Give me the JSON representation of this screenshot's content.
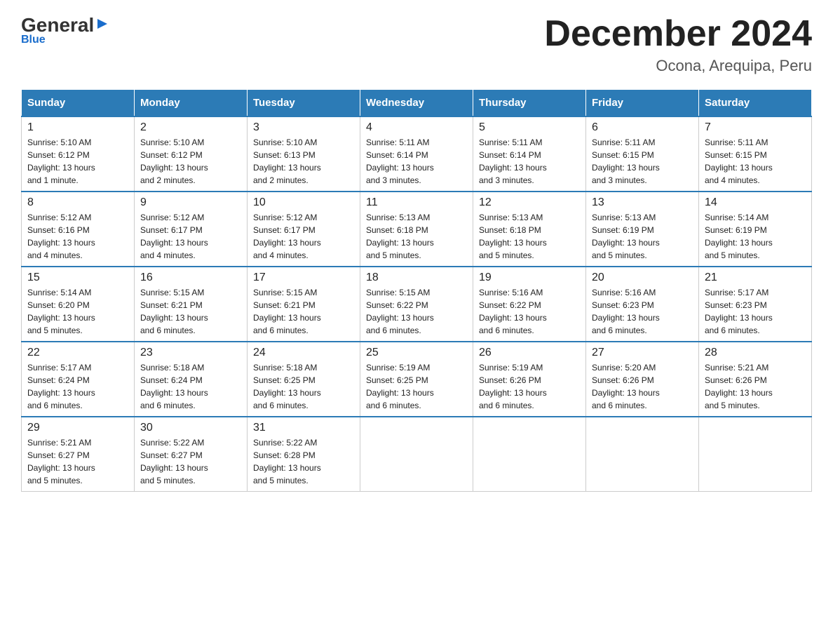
{
  "logo": {
    "general": "General",
    "blue": "Blue"
  },
  "title": "December 2024",
  "subtitle": "Ocona, Arequipa, Peru",
  "days_header": [
    "Sunday",
    "Monday",
    "Tuesday",
    "Wednesday",
    "Thursday",
    "Friday",
    "Saturday"
  ],
  "weeks": [
    [
      {
        "num": "1",
        "info": "Sunrise: 5:10 AM\nSunset: 6:12 PM\nDaylight: 13 hours\nand 1 minute."
      },
      {
        "num": "2",
        "info": "Sunrise: 5:10 AM\nSunset: 6:12 PM\nDaylight: 13 hours\nand 2 minutes."
      },
      {
        "num": "3",
        "info": "Sunrise: 5:10 AM\nSunset: 6:13 PM\nDaylight: 13 hours\nand 2 minutes."
      },
      {
        "num": "4",
        "info": "Sunrise: 5:11 AM\nSunset: 6:14 PM\nDaylight: 13 hours\nand 3 minutes."
      },
      {
        "num": "5",
        "info": "Sunrise: 5:11 AM\nSunset: 6:14 PM\nDaylight: 13 hours\nand 3 minutes."
      },
      {
        "num": "6",
        "info": "Sunrise: 5:11 AM\nSunset: 6:15 PM\nDaylight: 13 hours\nand 3 minutes."
      },
      {
        "num": "7",
        "info": "Sunrise: 5:11 AM\nSunset: 6:15 PM\nDaylight: 13 hours\nand 4 minutes."
      }
    ],
    [
      {
        "num": "8",
        "info": "Sunrise: 5:12 AM\nSunset: 6:16 PM\nDaylight: 13 hours\nand 4 minutes."
      },
      {
        "num": "9",
        "info": "Sunrise: 5:12 AM\nSunset: 6:17 PM\nDaylight: 13 hours\nand 4 minutes."
      },
      {
        "num": "10",
        "info": "Sunrise: 5:12 AM\nSunset: 6:17 PM\nDaylight: 13 hours\nand 4 minutes."
      },
      {
        "num": "11",
        "info": "Sunrise: 5:13 AM\nSunset: 6:18 PM\nDaylight: 13 hours\nand 5 minutes."
      },
      {
        "num": "12",
        "info": "Sunrise: 5:13 AM\nSunset: 6:18 PM\nDaylight: 13 hours\nand 5 minutes."
      },
      {
        "num": "13",
        "info": "Sunrise: 5:13 AM\nSunset: 6:19 PM\nDaylight: 13 hours\nand 5 minutes."
      },
      {
        "num": "14",
        "info": "Sunrise: 5:14 AM\nSunset: 6:19 PM\nDaylight: 13 hours\nand 5 minutes."
      }
    ],
    [
      {
        "num": "15",
        "info": "Sunrise: 5:14 AM\nSunset: 6:20 PM\nDaylight: 13 hours\nand 5 minutes."
      },
      {
        "num": "16",
        "info": "Sunrise: 5:15 AM\nSunset: 6:21 PM\nDaylight: 13 hours\nand 6 minutes."
      },
      {
        "num": "17",
        "info": "Sunrise: 5:15 AM\nSunset: 6:21 PM\nDaylight: 13 hours\nand 6 minutes."
      },
      {
        "num": "18",
        "info": "Sunrise: 5:15 AM\nSunset: 6:22 PM\nDaylight: 13 hours\nand 6 minutes."
      },
      {
        "num": "19",
        "info": "Sunrise: 5:16 AM\nSunset: 6:22 PM\nDaylight: 13 hours\nand 6 minutes."
      },
      {
        "num": "20",
        "info": "Sunrise: 5:16 AM\nSunset: 6:23 PM\nDaylight: 13 hours\nand 6 minutes."
      },
      {
        "num": "21",
        "info": "Sunrise: 5:17 AM\nSunset: 6:23 PM\nDaylight: 13 hours\nand 6 minutes."
      }
    ],
    [
      {
        "num": "22",
        "info": "Sunrise: 5:17 AM\nSunset: 6:24 PM\nDaylight: 13 hours\nand 6 minutes."
      },
      {
        "num": "23",
        "info": "Sunrise: 5:18 AM\nSunset: 6:24 PM\nDaylight: 13 hours\nand 6 minutes."
      },
      {
        "num": "24",
        "info": "Sunrise: 5:18 AM\nSunset: 6:25 PM\nDaylight: 13 hours\nand 6 minutes."
      },
      {
        "num": "25",
        "info": "Sunrise: 5:19 AM\nSunset: 6:25 PM\nDaylight: 13 hours\nand 6 minutes."
      },
      {
        "num": "26",
        "info": "Sunrise: 5:19 AM\nSunset: 6:26 PM\nDaylight: 13 hours\nand 6 minutes."
      },
      {
        "num": "27",
        "info": "Sunrise: 5:20 AM\nSunset: 6:26 PM\nDaylight: 13 hours\nand 6 minutes."
      },
      {
        "num": "28",
        "info": "Sunrise: 5:21 AM\nSunset: 6:26 PM\nDaylight: 13 hours\nand 5 minutes."
      }
    ],
    [
      {
        "num": "29",
        "info": "Sunrise: 5:21 AM\nSunset: 6:27 PM\nDaylight: 13 hours\nand 5 minutes."
      },
      {
        "num": "30",
        "info": "Sunrise: 5:22 AM\nSunset: 6:27 PM\nDaylight: 13 hours\nand 5 minutes."
      },
      {
        "num": "31",
        "info": "Sunrise: 5:22 AM\nSunset: 6:28 PM\nDaylight: 13 hours\nand 5 minutes."
      },
      null,
      null,
      null,
      null
    ]
  ]
}
